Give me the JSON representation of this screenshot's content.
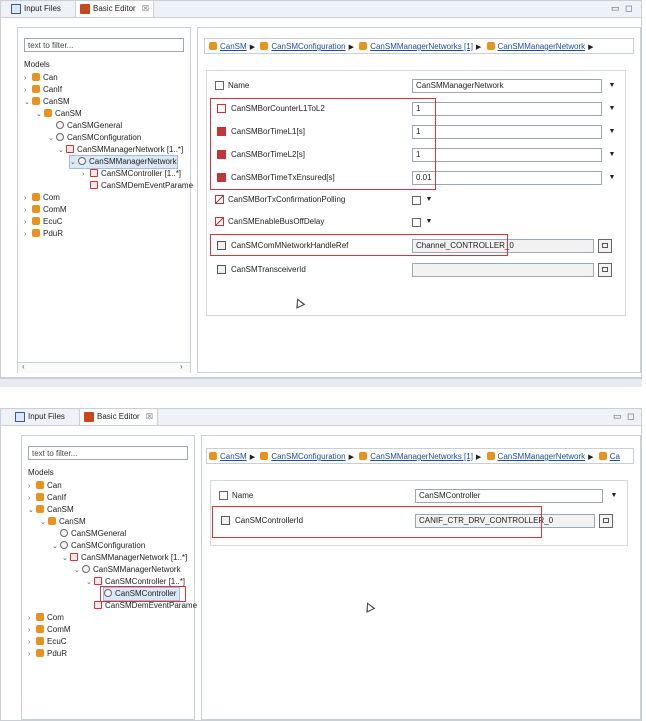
{
  "colors": {
    "highlight": "#d9323a",
    "link": "#1a4f9c",
    "module_icon": "#e8921f",
    "tab_bar": "#eef2f7"
  },
  "tabs": {
    "input_files": "Input Files",
    "basic_editor": "Basic Editor",
    "close_glyph": "☒"
  },
  "window": {
    "minimize": "▭",
    "maximize": "◻"
  },
  "filter": {
    "placeholder": "text to filter..."
  },
  "models_label": "Models",
  "tree1": [
    {
      "label": "Can"
    },
    {
      "label": "CanIf"
    },
    {
      "label": "CanSM"
    },
    {
      "label": "CanSM"
    },
    {
      "label": "CanSMGeneral"
    },
    {
      "label": "CanSMConfiguration"
    },
    {
      "label": "CanSMManagerNetwork [1..*]"
    },
    {
      "label": "CanSMManagerNetwork"
    },
    {
      "label": "CanSMController [1..*]"
    },
    {
      "label": "CanSMDemEventParame"
    },
    {
      "label": "Com"
    },
    {
      "label": "ComM"
    },
    {
      "label": "EcuC"
    },
    {
      "label": "PduR"
    }
  ],
  "tree2": [
    {
      "label": "Can"
    },
    {
      "label": "CanIf"
    },
    {
      "label": "CanSM"
    },
    {
      "label": "CanSM"
    },
    {
      "label": "CanSMGeneral"
    },
    {
      "label": "CanSMConfiguration"
    },
    {
      "label": "CanSMManagerNetwork [1..*]"
    },
    {
      "label": "CanSMManagerNetwork"
    },
    {
      "label": "CanSMController [1..*]"
    },
    {
      "label": "CanSMController"
    },
    {
      "label": "CanSMDemEventParame"
    },
    {
      "label": "Com"
    },
    {
      "label": "ComM"
    },
    {
      "label": "EcuC"
    },
    {
      "label": "PduR"
    }
  ],
  "breadcrumb1": [
    "CanSM",
    "CanSMConfiguration",
    "CanSMManagerNetworks [1]",
    "CanSMManagerNetwork"
  ],
  "breadcrumb2": [
    "CanSM",
    "CanSMConfiguration",
    "CanSMManagerNetworks [1]",
    "CanSMManagerNetwork",
    "Ca"
  ],
  "params1": {
    "name_label": "Name",
    "name_value": "CanSMManagerNetwork",
    "rows": [
      {
        "label": "CanSMBorCounterL1ToL2",
        "value": "1"
      },
      {
        "label": "CanSMBorTimeL1[s]",
        "value": "1"
      },
      {
        "label": "CanSMBorTimeL2[s]",
        "value": "1"
      },
      {
        "label": "CanSMBorTimeTxEnsured[s]",
        "value": "0.01"
      }
    ],
    "bool_rows": [
      {
        "label": "CanSMBorTxConfirmationPolling"
      },
      {
        "label": "CanSMEnableBusOffDelay"
      }
    ],
    "ref_rows": [
      {
        "label": "CanSMComMNetworkHandleRef",
        "value": "Channel_CONTROLLER_0"
      },
      {
        "label": "CanSMTransceiverId",
        "value": ""
      }
    ]
  },
  "params2": {
    "name_label": "Name",
    "name_value": "CanSMController",
    "ref_label": "CanSMControllerId",
    "ref_value": "CANIF_CTR_DRV_CONTROLLER_0"
  },
  "dropdown_glyph": "▼",
  "scroll_left": "‹",
  "scroll_right": "›"
}
